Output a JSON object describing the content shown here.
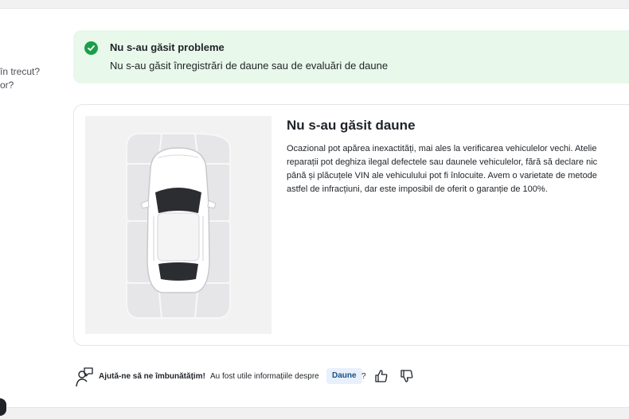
{
  "left_fragments": {
    "line1": "în trecut?",
    "line2": "or?"
  },
  "alert": {
    "icon": "check-circle-icon",
    "title": "Nu s-au găsit probleme",
    "message": "Nu s-au găsit înregistrări de daune sau de evaluări de daune",
    "accent": "#1e9e4a",
    "background": "#e8f8ea"
  },
  "damage_card": {
    "image": "car-top-view-damage-diagram",
    "title": "Nu s-au găsit daune",
    "paragraph_lines": [
      "Ocazional pot apărea inexactități, mai ales la verificarea vehiculelor vechi. Atelie",
      "reparații pot deghiza ilegal defectele sau daunele vehiculelor, fără să declare nic",
      "până și plăcuțele VIN ale vehiculului pot fi înlocuite. Avem o varietate de metode",
      "astfel de infracțiuni, dar este imposibil de oferit o garanție de 100%."
    ]
  },
  "feedback": {
    "icon": "feedback-person-icon",
    "prompt_strong": "Ajută-ne să ne îmbunătățim!",
    "prompt": "Au fost utile informațiile despre",
    "topic_chip": "Daune",
    "question_mark": "?",
    "thumbs_up": "thumbs-up-icon",
    "thumbs_down": "thumbs-down-icon"
  }
}
